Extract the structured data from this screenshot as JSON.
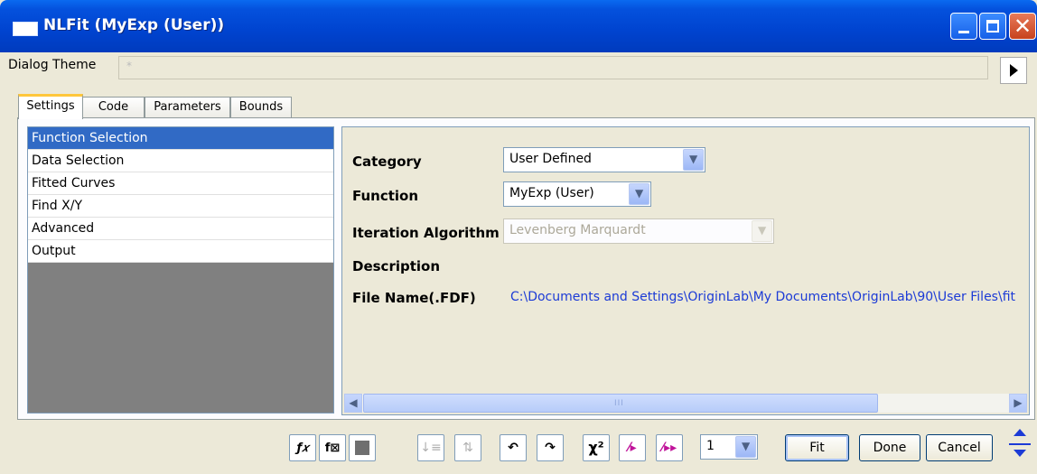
{
  "window": {
    "title": "NLFit (MyExp (User))"
  },
  "theme": {
    "label": "Dialog Theme",
    "value": "*"
  },
  "tabs": [
    {
      "label": "Settings"
    },
    {
      "label": "Code"
    },
    {
      "label": "Parameters"
    },
    {
      "label": "Bounds"
    }
  ],
  "nav": {
    "items": [
      {
        "label": "Function Selection"
      },
      {
        "label": "Data Selection"
      },
      {
        "label": "Fitted Curves"
      },
      {
        "label": "Find X/Y"
      },
      {
        "label": "Advanced"
      },
      {
        "label": "Output"
      }
    ]
  },
  "form": {
    "category_label": "Category",
    "category_value": "User Defined",
    "function_label": "Function",
    "function_value": "MyExp (User)",
    "iteration_label": "Iteration Algorithm",
    "iteration_value": "Levenberg Marquardt",
    "description_label": "Description",
    "filename_label": "File Name(.FDF)",
    "filename_value": "C:\\Documents and Settings\\OriginLab\\My Documents\\OriginLab\\90\\User Files\\fit"
  },
  "toolbar": {
    "count_value": "1",
    "fit_label": "Fit",
    "done_label": "Done",
    "cancel_label": "Cancel",
    "icons": [
      "function-builder-icon",
      "fx-icon",
      "save-icon",
      "sort-down-icon",
      "sort-up-icon",
      "undo-icon",
      "redo-icon",
      "chi-square-icon",
      "one-iteration-icon",
      "fit-until-converged-icon"
    ]
  },
  "colors": {
    "title_bar": "#0043cf",
    "selection": "#316ac5",
    "link": "#1c3bd6"
  }
}
